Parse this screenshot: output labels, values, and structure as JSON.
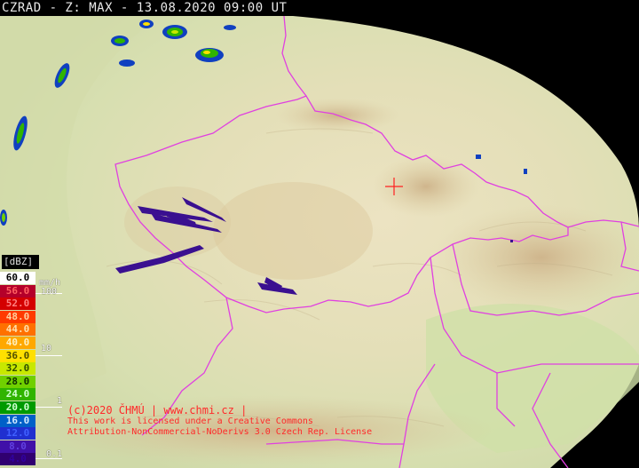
{
  "header": {
    "title": "CZRAD - Z: MAX - 13.08.2020 09:00 UT"
  },
  "legend": {
    "unit": "[dBZ]",
    "mmh_unit": "mm/h",
    "levels": [
      {
        "label": "60.0",
        "bg": "#ffffff",
        "fg": "#000000"
      },
      {
        "label": "56.0",
        "bg": "#b4002a",
        "fg": "#ff6060"
      },
      {
        "label": "52.0",
        "bg": "#d40000",
        "fg": "#ff8080"
      },
      {
        "label": "48.0",
        "bg": "#ff3a00",
        "fg": "#ffd0a0"
      },
      {
        "label": "44.0",
        "bg": "#ff7000",
        "fg": "#ffe0b0"
      },
      {
        "label": "40.0",
        "bg": "#ffa800",
        "fg": "#fff0c0"
      },
      {
        "label": "36.0",
        "bg": "#ffe000",
        "fg": "#505000"
      },
      {
        "label": "32.0",
        "bg": "#c8e800",
        "fg": "#305000"
      },
      {
        "label": "28.0",
        "bg": "#70d000",
        "fg": "#103000"
      },
      {
        "label": "24.0",
        "bg": "#30b400",
        "fg": "#d0ffd0"
      },
      {
        "label": "20.0",
        "bg": "#009a00",
        "fg": "#d0ffd0"
      },
      {
        "label": "16.0",
        "bg": "#0060c8",
        "fg": "#d0e8ff"
      },
      {
        "label": "12.0",
        "bg": "#2030d0",
        "fg": "#4060ff"
      },
      {
        "label": "8.0",
        "bg": "#4010a8",
        "fg": "#6040e0"
      },
      {
        "label": "4.0",
        "bg": "#300070",
        "fg": "#3000a0"
      }
    ],
    "mmh_ticks": [
      "100",
      "10",
      "1",
      "0.1"
    ]
  },
  "credit": {
    "line1": "(c)2020 ČHMÚ | www.chmi.cz |",
    "line2": "This work is licensed under a Creative Commons",
    "line3": "Attribution-NonCommercial-NoDerivs 3.0 Czech Rep. License"
  },
  "colors": {
    "border": "#e040e0",
    "radar_site": "#ff2020",
    "background": "#000000"
  }
}
